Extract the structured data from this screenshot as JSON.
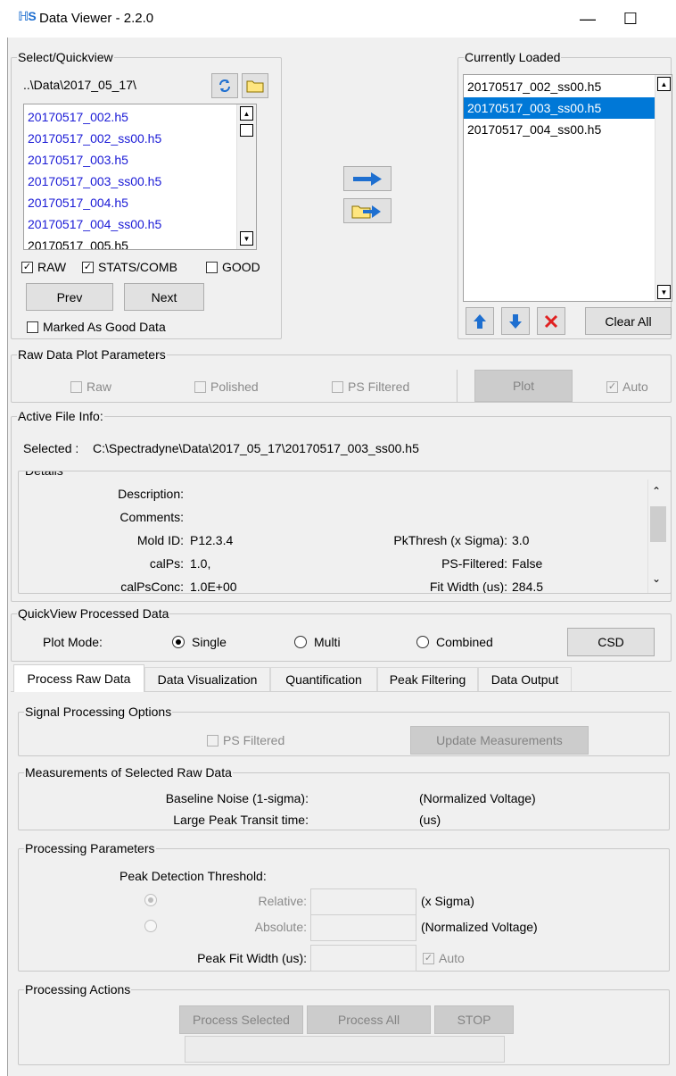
{
  "window": {
    "app_icon": "ℍS",
    "title": "Data Viewer - 2.2.0",
    "minimize_glyph": "—",
    "maximize_glyph": "☐"
  },
  "quickview": {
    "legend": "Select/Quickview",
    "path": "..\\Data\\2017_05_17\\",
    "files": [
      {
        "name": "20170517_002.h5",
        "color": "blue"
      },
      {
        "name": "20170517_002_ss00.h5",
        "color": "blue"
      },
      {
        "name": "20170517_003.h5",
        "color": "blue"
      },
      {
        "name": "20170517_003_ss00.h5",
        "color": "blue"
      },
      {
        "name": "20170517_004.h5",
        "color": "blue"
      },
      {
        "name": "20170517_004_ss00.h5",
        "color": "blue"
      },
      {
        "name": "20170517_005.h5",
        "color": "black"
      }
    ],
    "raw_label": "RAW",
    "stats_label": "STATS/COMB",
    "good_label": "GOOD",
    "prev_label": "Prev",
    "next_label": "Next",
    "marked_good_label": "Marked As Good Data"
  },
  "loaded": {
    "legend": "Currently Loaded",
    "files": [
      "20170517_002_ss00.h5",
      "20170517_003_ss00.h5",
      "20170517_004_ss00.h5"
    ],
    "selected_index": 1,
    "clear_all_label": "Clear All"
  },
  "raw_plot": {
    "legend": "Raw Data Plot Parameters",
    "raw_label": "Raw",
    "polished_label": "Polished",
    "ps_filtered_label": "PS Filtered",
    "plot_label": "Plot",
    "auto_label": "Auto"
  },
  "active_file": {
    "legend": "Active File Info:",
    "selected_prefix": "Selected :",
    "selected_path": "C:\\Spectradyne\\Data\\2017_05_17\\20170517_003_ss00.h5",
    "details_legend": "Details",
    "description_label": "Description:",
    "comments_label": "Comments:",
    "mold_id_label": "Mold ID:",
    "mold_id_value": "P12.3.4",
    "calps_label": "calPs:",
    "calps_value": "1.0,",
    "calpsconc_label": "calPsConc:",
    "calpsconc_value": "1.0E+00",
    "pkthresh_label": "PkThresh (x Sigma):",
    "pkthresh_value": "3.0",
    "psfiltered_label": "PS-Filtered:",
    "psfiltered_value": "False",
    "fitwidth_label": "Fit Width (us):",
    "fitwidth_value": "284.5"
  },
  "qv_processed": {
    "legend": "QuickView Processed Data",
    "plot_mode_label": "Plot Mode:",
    "single_label": "Single",
    "multi_label": "Multi",
    "combined_label": "Combined",
    "csd_label": "CSD"
  },
  "tabs": [
    "Process Raw Data",
    "Data Visualization",
    "Quantification",
    "Peak Filtering",
    "Data Output"
  ],
  "signal": {
    "legend": "Signal Processing Options",
    "ps_filtered_label": "PS Filtered",
    "update_label": "Update Measurements"
  },
  "measurements": {
    "legend": "Measurements of Selected Raw Data",
    "noise_label": "Baseline Noise (1-sigma):",
    "noise_unit": "(Normalized Voltage)",
    "transit_label": "Large Peak Transit time:",
    "transit_unit": "(us)"
  },
  "params": {
    "legend": "Processing Parameters",
    "threshold_label": "Peak Detection Threshold:",
    "relative_label": "Relative:",
    "relative_unit": "(x Sigma)",
    "absolute_label": "Absolute:",
    "absolute_unit": "(Normalized Voltage)",
    "fit_width_label": "Peak Fit Width (us):",
    "auto_label": "Auto"
  },
  "actions": {
    "legend": "Processing Actions",
    "process_selected_label": "Process Selected",
    "process_all_label": "Process All",
    "stop_label": "STOP"
  },
  "colors": {
    "accent": "#0078d7",
    "file_blue": "#1a1ad6",
    "arrow_blue": "#1e6fd0",
    "delete_red": "#e02020"
  }
}
